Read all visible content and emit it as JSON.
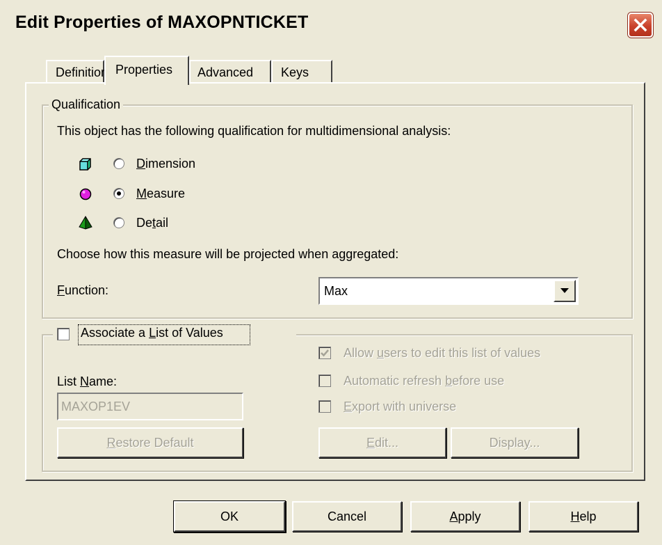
{
  "window": {
    "title": "Edit Properties of MAXOPNTICKET",
    "close_icon": "close-icon"
  },
  "tabs": [
    {
      "label": "Definition",
      "active": false
    },
    {
      "label": "Properties",
      "active": true
    },
    {
      "label": "Advanced",
      "active": false
    },
    {
      "label": "Keys",
      "active": false
    }
  ],
  "qualification": {
    "legend": "Qualification",
    "description": "This object has the following qualification for multidimensional analysis:",
    "options": [
      {
        "pre": "",
        "accel": "D",
        "post": "imension",
        "icon": "dimension-cube-icon",
        "selected": false
      },
      {
        "pre": "",
        "accel": "M",
        "post": "easure",
        "icon": "measure-sphere-icon",
        "selected": true
      },
      {
        "pre": "De",
        "accel": "t",
        "post": "ail",
        "icon": "detail-pyramid-icon",
        "selected": false
      }
    ],
    "projection_text": "Choose how this measure will be projected when aggregated:",
    "function_label_accel": "F",
    "function_label_rest": "unction:",
    "function_value": "Max"
  },
  "list_of_values": {
    "checkbox_pre": "Associate a ",
    "checkbox_accel": "L",
    "checkbox_post": "ist of Values",
    "checked": false,
    "list_name_pre": "List ",
    "list_name_accel": "N",
    "list_name_post": "ame:",
    "list_name_value": "MAXOP1EV",
    "restore_accel": "R",
    "restore_rest": "estore Default",
    "options": [
      {
        "pre": "Allow ",
        "accel": "u",
        "post": "sers to edit this list of values",
        "checked": true
      },
      {
        "pre": "Automatic refresh ",
        "accel": "b",
        "post": "efore use",
        "checked": false
      },
      {
        "pre": "",
        "accel": "E",
        "post": "xport with universe",
        "checked": false
      }
    ],
    "edit_accel": "E",
    "edit_rest": "dit...",
    "display_pre": "Displa",
    "display_accel": "y",
    "display_post": "..."
  },
  "footer": {
    "ok": "OK",
    "cancel": "Cancel",
    "apply_accel": "A",
    "apply_rest": "pply",
    "help_accel": "H",
    "help_rest": "elp"
  }
}
